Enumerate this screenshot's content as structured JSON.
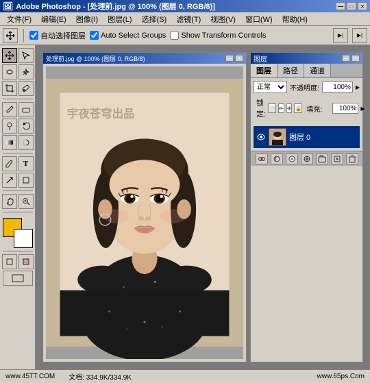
{
  "titlebar": {
    "title": "Adobe Photoshop - [处理前.jpg @ 100% (图层 0, RGB/8)]",
    "buttons": [
      "_",
      "□",
      "×"
    ]
  },
  "menubar": {
    "items": [
      "文件(F)",
      "编辑(E)",
      "图像(I)",
      "图层(L)",
      "选择(S)",
      "滤镜(T)",
      "视图(V)",
      "窗口(W)",
      "帮助(H)"
    ]
  },
  "toolbar": {
    "auto_select_layer_label": "自动选择图层",
    "auto_select_groups_label": "Auto Select Groups",
    "show_transform_label": "Show Transform Controls",
    "auto_select_layer_checked": true,
    "auto_select_groups_checked": true,
    "show_transform_checked": false
  },
  "canvas": {
    "title": "处理前.jpg @ 100% (图层 0, RGB/8)",
    "watermark": "宇夜苍穹出品"
  },
  "layers_panel": {
    "title": "图层",
    "tabs": [
      "图层",
      "路径",
      "通道"
    ],
    "blend_mode": "正常",
    "opacity_label": "不透明度:",
    "opacity_value": "100%",
    "lock_label": "锁定:",
    "fill_label": "填充:",
    "fill_value": "100%",
    "layers": [
      {
        "name": "图层 0",
        "visible": true,
        "active": true
      }
    ]
  },
  "statusbar": {
    "left": "www.45TT.COM",
    "doc_label": "文档:",
    "doc_value": "334.9K/334.9K",
    "right": "www.65ps.Com"
  },
  "icons": {
    "eye": "●",
    "lock": "🔒",
    "move": "✛",
    "arrow": "↖",
    "lasso": "⊙",
    "crop": "⊡",
    "brush": "✏",
    "eraser": "◻",
    "text": "T",
    "shape": "□",
    "zoom": "⊕",
    "hand": "✋",
    "eye_dropper": "✒",
    "gradient": "▦",
    "pen": "✒",
    "dodge": "◑",
    "minimize": "—",
    "maximize": "□",
    "close": "×"
  }
}
